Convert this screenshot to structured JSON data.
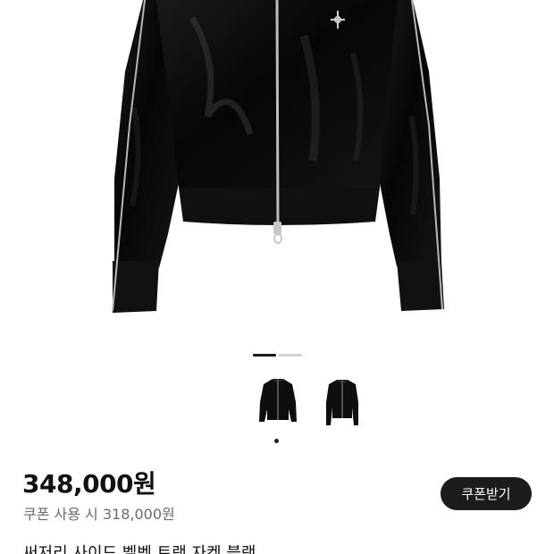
{
  "gallery": {
    "slide_count": 2,
    "active_slide": 1,
    "selected_thumbnail": 1
  },
  "product": {
    "price": "348,000원",
    "coupon_price": "쿠폰 사용 시 318,000원",
    "coupon_button_label": "쿠폰받기",
    "title": "써저리 사이드 벨벳 트랙 자켓 블랙"
  },
  "colors": {
    "jacket": "#0d0d0d",
    "button_bg": "#1c1c1c",
    "indicator_active": "#1a1a1a",
    "indicator_inactive": "#d4d4d4"
  }
}
